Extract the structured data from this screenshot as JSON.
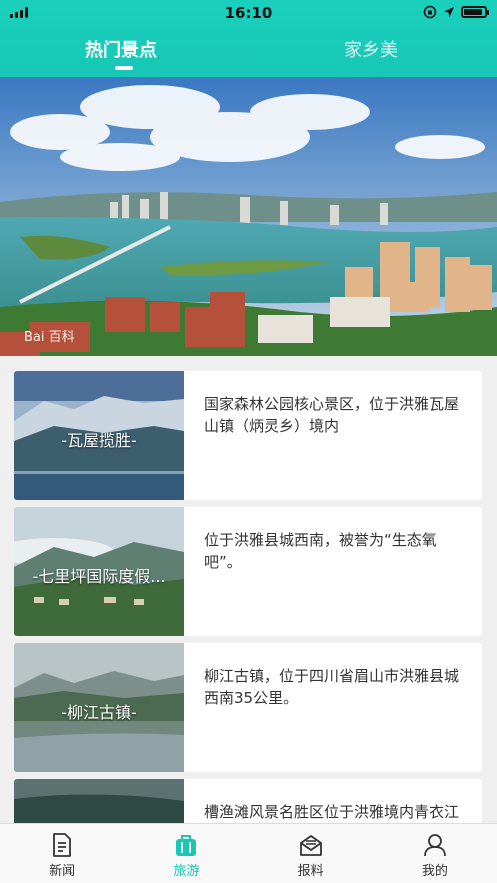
{
  "status_bar": {
    "time": "16:10"
  },
  "top_tabs": [
    {
      "label": "热门景点",
      "active": true
    },
    {
      "label": "家乡美",
      "active": false
    }
  ],
  "banner": {
    "watermark": "Bai 百科"
  },
  "spots": [
    {
      "title": "-瓦屋揽胜-",
      "desc": "国家森林公园核心景区，位于洪雅瓦屋山镇（炳灵乡）境内"
    },
    {
      "title": "-七里坪国际度假...",
      "desc": "位于洪雅县城西南，被誉为“生态氧吧”。"
    },
    {
      "title": "-柳江古镇-",
      "desc": "柳江古镇，位于四川省眉山市洪雅县城西南35公里。"
    },
    {
      "title": "",
      "desc": "槽渔滩风景名胜区位于洪雅境内青衣江上游"
    }
  ],
  "bottom_nav": [
    {
      "label": "新闻",
      "icon": "news-icon",
      "active": false
    },
    {
      "label": "旅游",
      "icon": "suitcase-icon",
      "active": true
    },
    {
      "label": "报料",
      "icon": "mail-icon",
      "active": false
    },
    {
      "label": "我的",
      "icon": "user-icon",
      "active": false
    }
  ],
  "colors": {
    "accent": "#18c7b6",
    "header": "#1ad0bd"
  }
}
